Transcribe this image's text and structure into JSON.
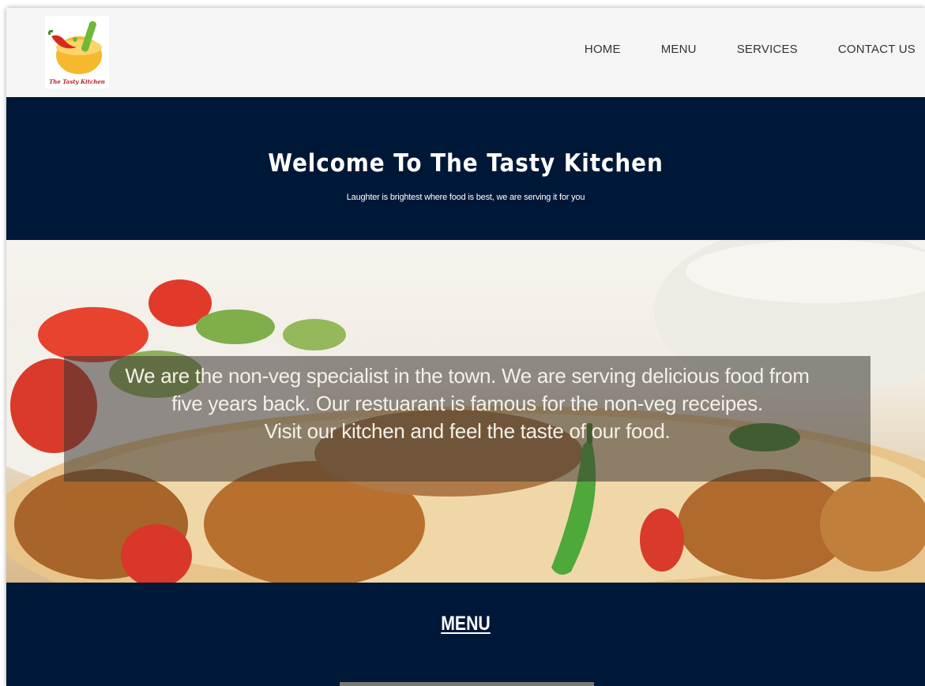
{
  "brand": {
    "logo_text": "The Tasty Kitchen"
  },
  "nav": {
    "items": [
      {
        "label": "HOME"
      },
      {
        "label": "MENU"
      },
      {
        "label": "SERVICES"
      },
      {
        "label": "CONTACT US"
      }
    ]
  },
  "hero": {
    "title": "Welcome To The Tasty Kitchen",
    "subtitle": "Laughter is brightest where food is best, we are serving it for you"
  },
  "about": {
    "lines": [
      "We are the non-veg specialist in the town. We are serving delicious food from",
      "five years back. Our restuarant is famous for the non-veg receipes.",
      "Visit our kitchen and feel the taste of our food."
    ]
  },
  "menu": {
    "title": "MENU"
  },
  "colors": {
    "nav_bg": "#f5f5f5",
    "section_bg": "#001838",
    "text_light": "#ffffff"
  }
}
